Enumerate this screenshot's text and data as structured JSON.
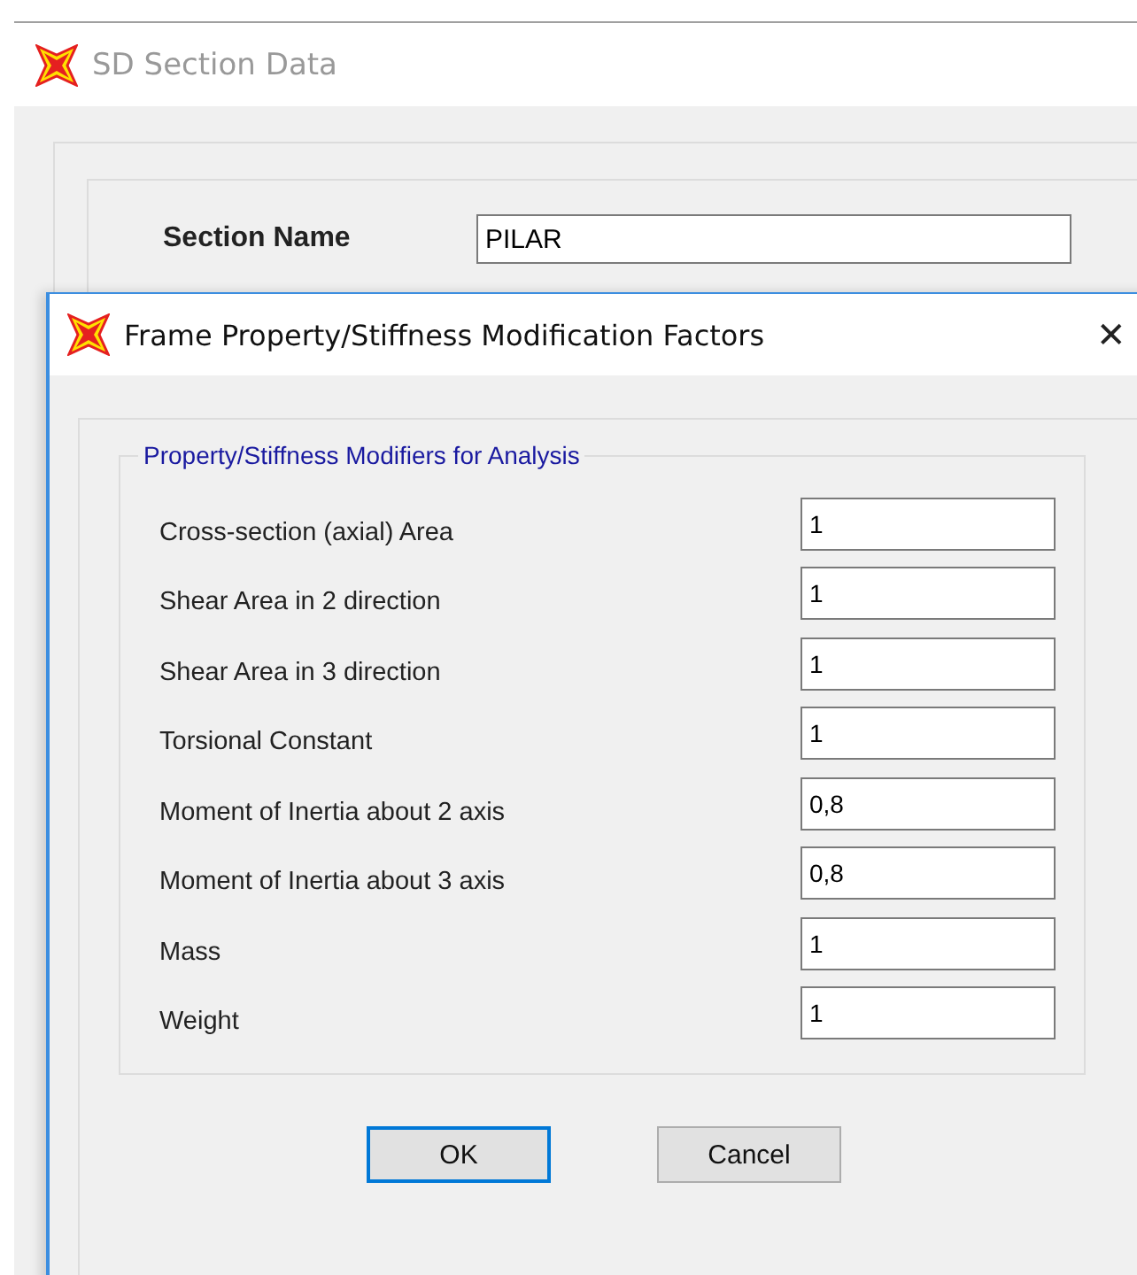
{
  "back_window": {
    "title": "SD Section Data",
    "section_name_label": "Section Name",
    "section_name_value": "PILAR"
  },
  "dialog": {
    "title": "Frame Property/Stiffness Modification Factors",
    "close": "✕",
    "group_title": "Property/Stiffness Modifiers for Analysis",
    "modifiers": [
      {
        "label": "Cross-section (axial) Area",
        "value": "1"
      },
      {
        "label": "Shear Area in 2 direction",
        "value": "1"
      },
      {
        "label": "Shear Area in 3 direction",
        "value": "1"
      },
      {
        "label": "Torsional Constant",
        "value": "1"
      },
      {
        "label": "Moment of Inertia about 2 axis",
        "value": "0,8"
      },
      {
        "label": "Moment of Inertia about 3 axis",
        "value": "0,8"
      },
      {
        "label": "Mass",
        "value": "1"
      },
      {
        "label": "Weight",
        "value": "1"
      }
    ],
    "buttons": [
      {
        "label": "OK",
        "selected": true
      },
      {
        "label": "Cancel",
        "selected": false
      }
    ]
  }
}
